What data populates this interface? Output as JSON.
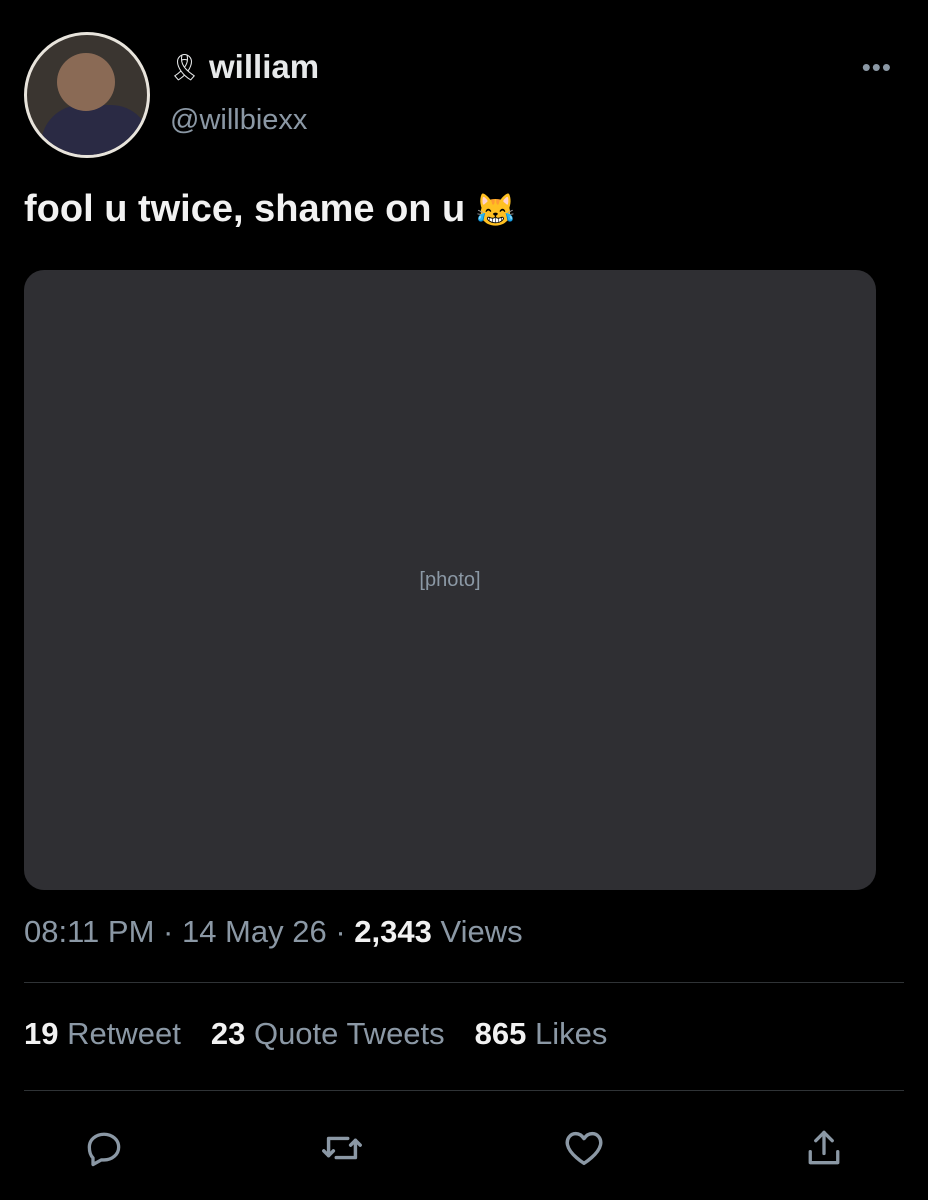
{
  "author": {
    "name_icon": "ribbon-icon",
    "name": "william",
    "handle": "@willbiexx"
  },
  "tweet": {
    "text": "fool u twice, shame on u",
    "emoji": "😹"
  },
  "media": {
    "label": "[photo]"
  },
  "meta": {
    "time": "08:11 PM",
    "sep1": " · ",
    "date": "14 May 26",
    "sep2": " · ",
    "views_count": "2,343",
    "views_label": " Views"
  },
  "stats": {
    "retweets_count": "19",
    "retweets_label": "Retweet",
    "quotes_count": "23",
    "quotes_label": "Quote Tweets",
    "likes_count": "865",
    "likes_label": "Likes"
  },
  "icons": {
    "more": "more-icon",
    "reply": "reply-icon",
    "retweet": "retweet-icon",
    "like": "heart-icon",
    "share": "share-icon"
  }
}
